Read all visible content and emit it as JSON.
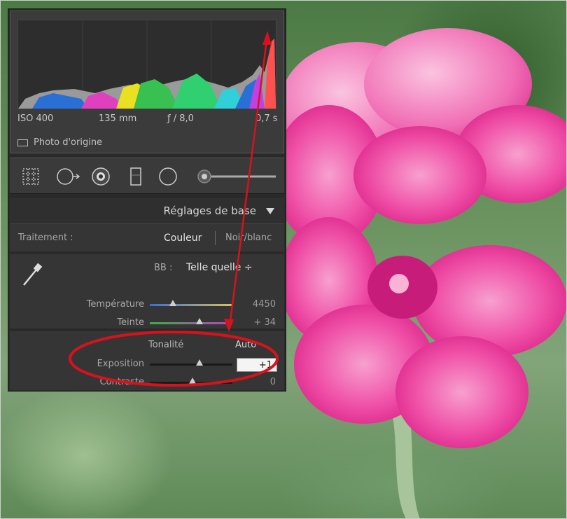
{
  "histogram": {
    "iso": "ISO 400",
    "focal": "135 mm",
    "aperture": "ƒ / 8,0",
    "shutter": "0,7 s",
    "original_photo_label": "Photo d'origine"
  },
  "tools": [
    "crop-overlay-icon",
    "spot-removal-icon",
    "red-eye-icon",
    "graduated-filter-icon",
    "radial-filter-icon",
    "adjustment-brush-slider"
  ],
  "panel": {
    "section_title": "Réglages de base",
    "treatment_label": "Traitement :",
    "treatment_color": "Couleur",
    "treatment_bw": "Noir/blanc",
    "wb_label": "BB :",
    "wb_value": "Telle quelle ÷",
    "temperature_label": "Température",
    "temperature_value": "4450",
    "tint_label": "Teinte",
    "tint_value": "+ 34",
    "tone_label": "Tonalité",
    "tone_auto": "Auto",
    "exposure_label": "Exposition",
    "exposure_value": "+1",
    "contrast_label": "Contraste",
    "contrast_value": "0"
  },
  "annotation_color": "#d8121c",
  "highlight_clip_color": "#e05cf0"
}
